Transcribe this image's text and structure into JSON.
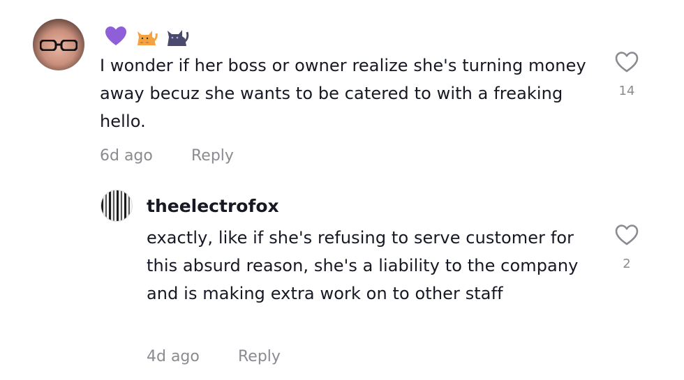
{
  "comment": {
    "emojis": [
      "purple-heart",
      "orange-cat",
      "black-cat"
    ],
    "text": "I wonder if her boss or owner realize she's turning money away becuz she wants to be catered to with a freaking hello.",
    "time": "6d ago",
    "reply_label": "Reply",
    "likes": "14"
  },
  "reply": {
    "username": "theelectrofox",
    "text": "exactly, like if she's refusing to serve customer for this absurd reason, she's a liability to the company and is making extra work on to other staff",
    "time": "4d ago",
    "reply_label": "Reply",
    "likes": "2"
  },
  "colors": {
    "text": "#161823",
    "meta": "#8a8b91",
    "purple": "#8e5fd8",
    "orange_cat": "#f4a340",
    "black_cat": "#4b4a6e"
  }
}
